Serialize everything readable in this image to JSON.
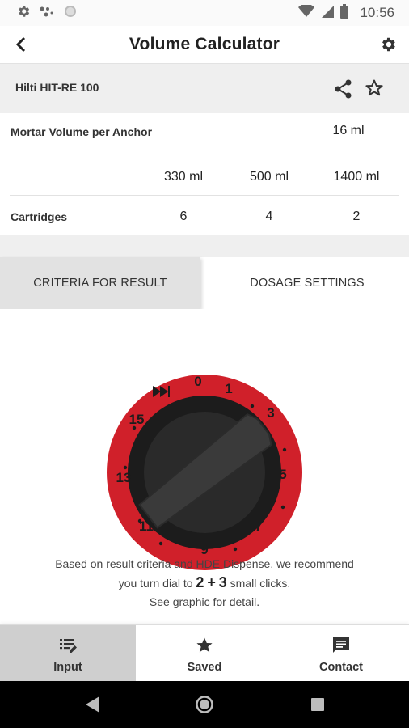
{
  "status_bar": {
    "time": "10:56",
    "icons": [
      "settings-icon",
      "assistant-dots-icon",
      "circle-icon",
      "wifi-icon",
      "signal-icon",
      "battery-icon"
    ]
  },
  "app_bar": {
    "title": "Volume Calculator",
    "icons": [
      "back-arrow-icon",
      "gear-icon"
    ]
  },
  "product": {
    "name": "Hilti HIT-RE 100",
    "icons": [
      "share-icon",
      "star-outline-icon"
    ]
  },
  "results": {
    "mortar_label": "Mortar Volume per Anchor",
    "mortar_value": "16 ml",
    "sizes": [
      "330 ml",
      "500 ml",
      "1400 ml"
    ],
    "cartridges_label": "Cartridges",
    "cartridges": [
      "6",
      "4",
      "2"
    ]
  },
  "tabs": [
    {
      "label": "CRITERIA FOR RESULT",
      "selected": false
    },
    {
      "label": "DOSAGE SETTINGS",
      "selected": true
    }
  ],
  "dial": {
    "numbers": [
      "0",
      "1",
      "3",
      "5",
      "7",
      "9",
      "11",
      "13",
      "15"
    ],
    "fast_forward_icon": "fast-forward-icon",
    "colors": {
      "ring": "#d0202a",
      "knob": "#1c1c1c",
      "bar": "#3a3a3a"
    }
  },
  "recommendation": {
    "line1": "Based on result criteria and HDE Dispense, we recommend",
    "line2_prefix": "you turn dial to",
    "value_a": "2",
    "plus": "+",
    "value_b": "3",
    "line2_suffix": "small clicks.",
    "line3": "See graphic for detail."
  },
  "bottom_nav": [
    {
      "label": "Input",
      "icon": "edit-list-icon",
      "active": true
    },
    {
      "label": "Saved",
      "icon": "star-icon",
      "active": false
    },
    {
      "label": "Contact",
      "icon": "message-icon",
      "active": false
    }
  ],
  "system_nav": {
    "icons": [
      "back-triangle-icon",
      "home-circle-icon",
      "recents-square-icon"
    ]
  }
}
